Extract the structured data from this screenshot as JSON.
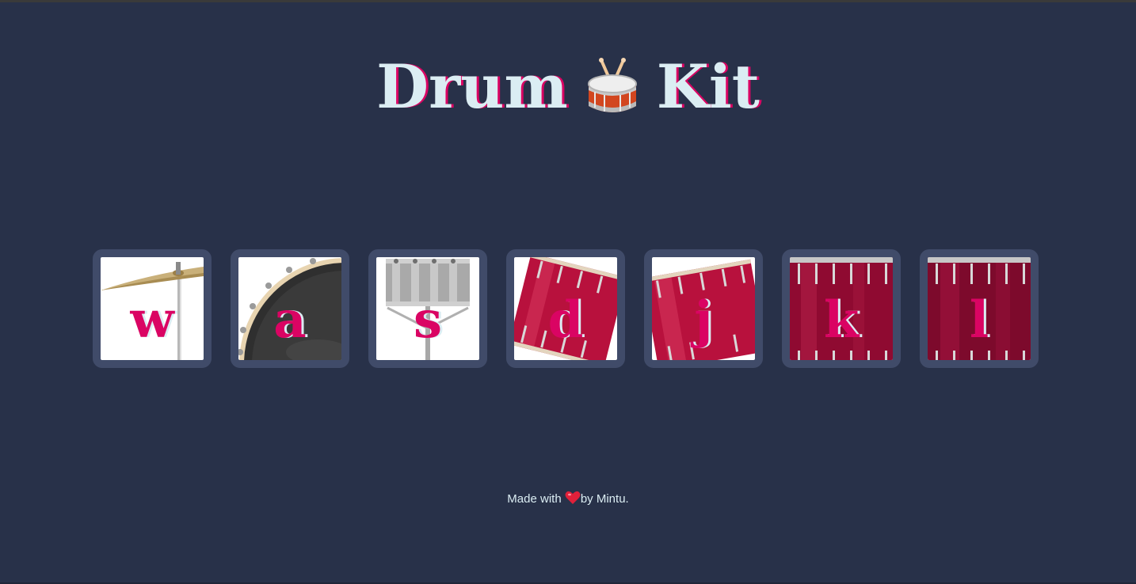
{
  "page": {
    "title_left": "Drum",
    "title_right": "Kit",
    "title_icon": "drum-with-drumsticks-icon"
  },
  "drums": [
    {
      "key": "w",
      "icon": "crash-cymbal-icon"
    },
    {
      "key": "a",
      "icon": "kick-drum-icon"
    },
    {
      "key": "s",
      "icon": "snare-drum-icon"
    },
    {
      "key": "d",
      "icon": "tom1-icon"
    },
    {
      "key": "j",
      "icon": "tom2-icon"
    },
    {
      "key": "k",
      "icon": "tom3-icon"
    },
    {
      "key": "l",
      "icon": "tom4-icon"
    }
  ],
  "footer": {
    "prefix": "Made with ",
    "icon": "heart-icon",
    "suffix": "by Mintu."
  },
  "colors": {
    "background": "#283149",
    "button_border": "#404B69",
    "accent": "#DA0463",
    "text": "#DBEDF3"
  }
}
